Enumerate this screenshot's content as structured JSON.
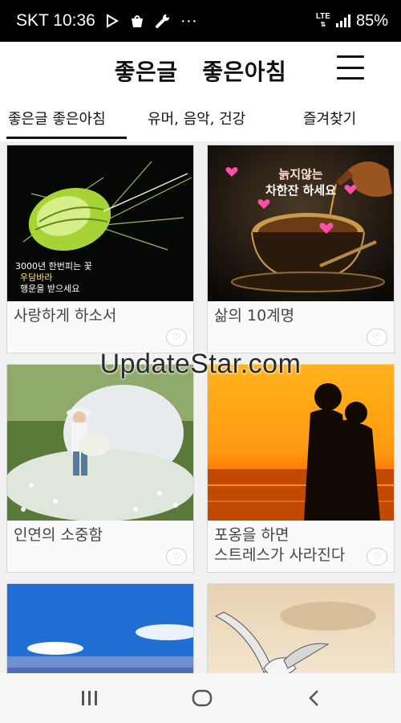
{
  "status_bar": {
    "carrier_time": "SKT 10:36",
    "more_dots": "···",
    "network": "LTE",
    "battery": "85%"
  },
  "header": {
    "title": "좋은글   좋은아침",
    "menu_icon": "hamburger-menu-icon"
  },
  "tabs": [
    {
      "label": "좋은글 좋은아침",
      "active": true
    },
    {
      "label": "유머, 음악, 건강",
      "active": false
    },
    {
      "label": "즐겨찾기",
      "active": false
    }
  ],
  "cards": [
    {
      "title": "사랑하게 하소서",
      "image_caption": [
        "3000년 한번피는 꽃",
        "우담바라",
        "행운을 받으세요"
      ]
    },
    {
      "title": "삶의 10계명",
      "image_caption": [
        "늙지않는",
        "차한잔 하세요"
      ]
    },
    {
      "title": "인연의 소중함"
    },
    {
      "title": "포옹을 하면\n스트레스가 사라진다"
    },
    {
      "title": ""
    },
    {
      "title": ""
    }
  ],
  "watermark": "UpdateStar.com",
  "colors": {
    "tab_indicator": "#111111",
    "status_bar_bg": "#000000"
  }
}
